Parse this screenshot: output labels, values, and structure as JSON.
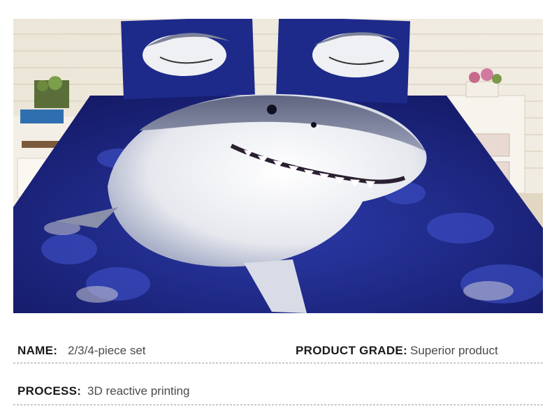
{
  "product_photo": {
    "subject": "3D great white shark bedding set on bed in bedroom"
  },
  "specs": {
    "name_label": "NAME:",
    "name_value": "2/3/4-piece set",
    "grade_label": "PRODUCT GRADE:",
    "grade_value": "Superior product",
    "process_label": "PROCESS:",
    "process_value": "3D reactive printing"
  },
  "colors": {
    "bedding_blue": "#1f2a8a",
    "shark_white": "#f2f2f2",
    "wall": "#e8e2d3",
    "label_text": "#1a1a1a",
    "value_text": "#4a4a4a"
  }
}
